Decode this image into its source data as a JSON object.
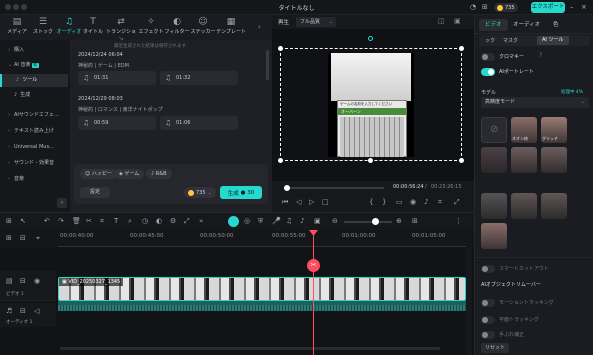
{
  "window": {
    "title": "タイトルなし",
    "credits": "735",
    "export_label": "エクスポート"
  },
  "toptabs": [
    {
      "icon": "▤",
      "label": "メディア"
    },
    {
      "icon": "☰",
      "label": "ストック"
    },
    {
      "icon": "♫",
      "label": "オーディオ"
    },
    {
      "icon": "T",
      "label": "タイトル"
    },
    {
      "icon": "⇄",
      "label": "トランジション"
    },
    {
      "icon": "✧",
      "label": "エフェクト"
    },
    {
      "icon": "◐",
      "label": "フィルター"
    },
    {
      "icon": "☺",
      "label": "ステッカー"
    },
    {
      "icon": "▦",
      "label": "テンプレート"
    }
  ],
  "leftnav": {
    "items": [
      "購入",
      "AI 音楽",
      "ツール",
      "生成",
      "AIサウンドエフェ...",
      "テキスト読み上げ",
      "Universal Mus...",
      "サウンド - 効果音",
      "音楽"
    ],
    "badge": "新"
  },
  "content": {
    "hint": "最近生成された結果は保存されます",
    "group1": {
      "date": "2024/12/24 06:04",
      "meta": "神秘的 | ゲーム | EDM",
      "t1": "01:31",
      "t2": "01:32"
    },
    "group2": {
      "date": "2024/12/29 08:03",
      "meta": "神秘的 | ロマンス | 東洋ナイトポップ",
      "t1": "00:59",
      "t2": "01:06"
    },
    "chips": [
      "ハッピー",
      "ゲーム",
      "R&B"
    ],
    "settings_label": "設定",
    "credits": "735",
    "generate_label": "生成",
    "generate_cost": "30"
  },
  "preview": {
    "tab_label": "再生",
    "quality": "フル品質",
    "game_title": "オーバーン",
    "game_header": "ゲームの名前を入力してください",
    "current_time": "00:00:56:24",
    "total_time": "00:23:26:15"
  },
  "right": {
    "tabs": [
      "ビデオ",
      "オーディオ",
      "色"
    ],
    "subtabs": [
      "ック",
      "マスク",
      "AI ツール"
    ],
    "chroma_label": "クロマキー",
    "portrait_label": "AIポートレート",
    "model_label": "モデル",
    "model_status": "処理中 4%",
    "model_value": "高精度モード",
    "presets": [
      "",
      "ネオン枠",
      "グリッチ",
      "",
      "",
      "",
      "",
      "",
      "",
      ""
    ],
    "sections": [
      "スマートカットアウト",
      "AIオブジェクトリムーバー",
      "モーショントラッキング",
      "平面トラッキング",
      "手ぶれ補正"
    ],
    "reset_label": "リセット"
  },
  "timeline": {
    "ruler": [
      "00:00:40:00",
      "00:00:45:00",
      "00:00:50:00",
      "00:00:55:00",
      "00:01:00:00",
      "00:01:05:00"
    ],
    "clip_name": "VID_20250327_1345",
    "track_video": "ビデオ 1",
    "track_audio": "オーディオ 1"
  },
  "colors": {
    "accent": "#25d9cf",
    "playhead": "#ff4d5e"
  }
}
